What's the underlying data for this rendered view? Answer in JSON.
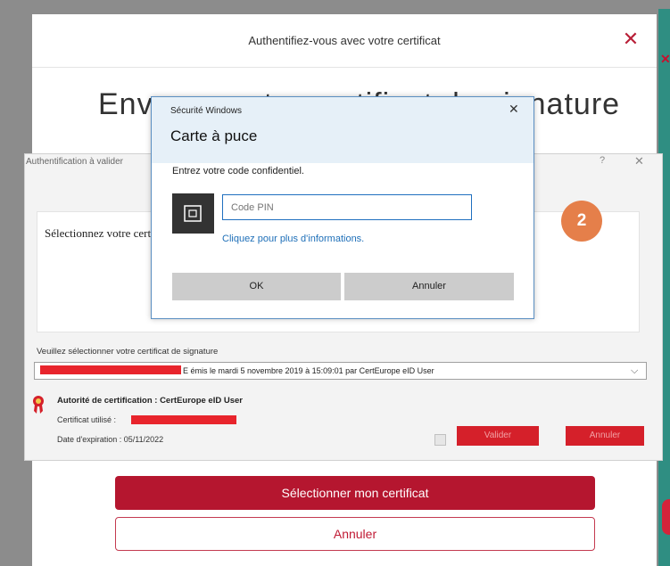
{
  "web_modal": {
    "title": "Authentifiez-vous avec votre certificat",
    "close_glyph": "✕",
    "big_heading": "Envoyez votre certificat de signature",
    "select_button": "Sélectionner mon certificat",
    "cancel_button": "Annuler"
  },
  "auth_dialog": {
    "title": "Authentification à valider",
    "help_glyph": "?",
    "close_glyph": "✕",
    "prompt": "Sélectionnez votre certificat",
    "select_label": "Veuillez sélectionner votre certificat de signature",
    "certificate_text": "E émis le mardi 5 novembre 2019 à 15:09:01 par CertEurope eID User",
    "chevron_glyph": "⌵",
    "authority": "Autorité de certification : CertEurope eID User",
    "cert_used_label": "Certificat utilisé :",
    "expiry": "Date d'expiration : 05/11/2022",
    "validate_button": "Valider",
    "cancel_button": "Annuler"
  },
  "windows_security": {
    "title": "Sécurité Windows",
    "close_glyph": "✕",
    "heading": "Carte à puce",
    "pin_prompt": "Entrez votre code confidentiel.",
    "pin_placeholder": "Code PIN",
    "more_info_link": "Cliquez pour plus d'informations.",
    "ok_button": "OK",
    "cancel_button": "Annuler"
  },
  "step_badge": "2",
  "colors": {
    "brand_red": "#b5162f",
    "badge_orange": "#e57f4a",
    "windows_blue": "#1e6fb8",
    "teal_strip": "#2f8e82"
  },
  "icons": {
    "smart_card": "smart-card-icon",
    "ribbon": "award-ribbon-icon"
  }
}
